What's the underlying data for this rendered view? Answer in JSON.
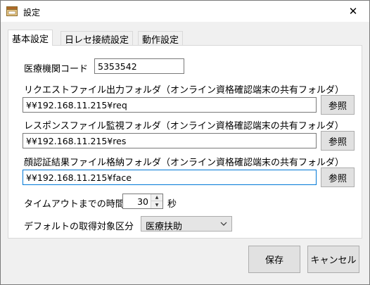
{
  "window": {
    "title": "設定",
    "close_glyph": "✕"
  },
  "tabs": [
    {
      "label": "基本設定",
      "active": true
    },
    {
      "label": "日レセ接続設定",
      "active": false
    },
    {
      "label": "動作設定",
      "active": false
    }
  ],
  "form": {
    "institution_code": {
      "label": "医療機関コード",
      "value": "5353542"
    },
    "request_folder": {
      "label": "リクエストファイル出力フォルダ（オンライン資格確認端末の共有フォルダ）",
      "value": "¥¥192.168.11.215¥req",
      "browse": "参照"
    },
    "response_folder": {
      "label": "レスポンスファイル監視フォルダ（オンライン資格確認端末の共有フォルダ）",
      "value": "¥¥192.168.11.215¥res",
      "browse": "参照"
    },
    "face_folder": {
      "label": "顔認証結果ファイル格納フォルダ（オンライン資格確認端末の共有フォルダ）",
      "value": "¥¥192.168.11.215¥face",
      "browse": "参照"
    },
    "timeout": {
      "label": "タイムアウトまでの時間",
      "value": "30",
      "unit": "秒"
    },
    "default_category": {
      "label": "デフォルトの取得対象区分",
      "value": "医療扶助"
    }
  },
  "footer": {
    "save_label": "保存",
    "cancel_label": "キャンセル"
  },
  "icons": {
    "app": "app-window-icon",
    "close": "close-icon",
    "spin_up": "spin-up-icon",
    "spin_down": "spin-down-icon",
    "dropdown": "chevron-down-icon"
  }
}
